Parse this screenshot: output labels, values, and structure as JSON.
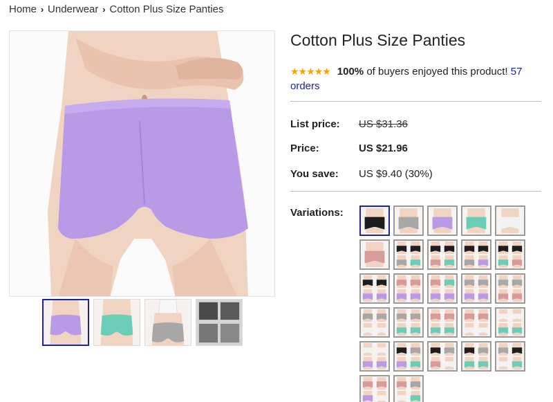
{
  "breadcrumb": {
    "home": "Home",
    "category": "Underwear",
    "current": "Cotton Plus Size Panties"
  },
  "product": {
    "title": "Cotton Plus Size Panties",
    "stars": "★★★★★",
    "rating_percent": "100%",
    "rating_text": "of buyers enjoyed this product!",
    "orders_link": "57 orders",
    "list_price_label": "List price:",
    "list_price": "US $31.36",
    "price_label": "Price:",
    "price": "US $21.96",
    "save_label": "You save:",
    "save": "US $9.40 (30%)",
    "variations_label": "Variations:"
  },
  "colors": {
    "accent_link": "#1a24a8",
    "star": "#f5a400",
    "lavender": "#b89ae6",
    "mint": "#6ccdb6",
    "gray": "#a7a7a7",
    "black": "#1d1d1d",
    "white": "#f2f2f2",
    "pink": "#d99a9a",
    "skin": "#f1d3c1"
  },
  "thumbnails": [
    "lavender",
    "mint",
    "gray",
    "gray-fabric"
  ],
  "variations": [
    [
      "black"
    ],
    [
      "gray"
    ],
    [
      "lavender"
    ],
    [
      "mint"
    ],
    [
      "white"
    ],
    [
      "pink"
    ],
    [
      "black",
      "black",
      "gray",
      "mint"
    ],
    [
      "black",
      "black",
      "pink",
      "mint"
    ],
    [
      "black",
      "black",
      "gray",
      "lavender"
    ],
    [
      "black",
      "black",
      "mint",
      "pink"
    ],
    [
      "black",
      "black",
      "lavender",
      "lavender"
    ],
    [
      "pink",
      "pink",
      "lavender",
      "lavender"
    ],
    [
      "pink",
      "mint",
      "lavender",
      "lavender"
    ],
    [
      "gray",
      "gray",
      "lavender",
      "lavender"
    ],
    [
      "gray",
      "gray",
      "pink",
      "pink"
    ],
    [
      "gray",
      "gray",
      "white",
      "white"
    ],
    [
      "gray",
      "gray",
      "mint",
      "mint"
    ],
    [
      "pink",
      "pink",
      "mint",
      "mint"
    ],
    [
      "pink",
      "pink",
      "white",
      "white"
    ],
    [
      "white",
      "white",
      "mint",
      "mint"
    ],
    [
      "white",
      "white",
      "lavender",
      "lavender"
    ],
    [
      "black",
      "gray",
      "lavender",
      "mint"
    ],
    [
      "black",
      "gray",
      "pink",
      "white"
    ],
    [
      "black",
      "gray",
      "mint",
      "mint"
    ],
    [
      "gray",
      "black",
      "white",
      "mint"
    ],
    [
      "pink",
      "pink",
      "lavender",
      "white"
    ],
    [
      "pink",
      "gray",
      "white",
      "mint"
    ]
  ]
}
